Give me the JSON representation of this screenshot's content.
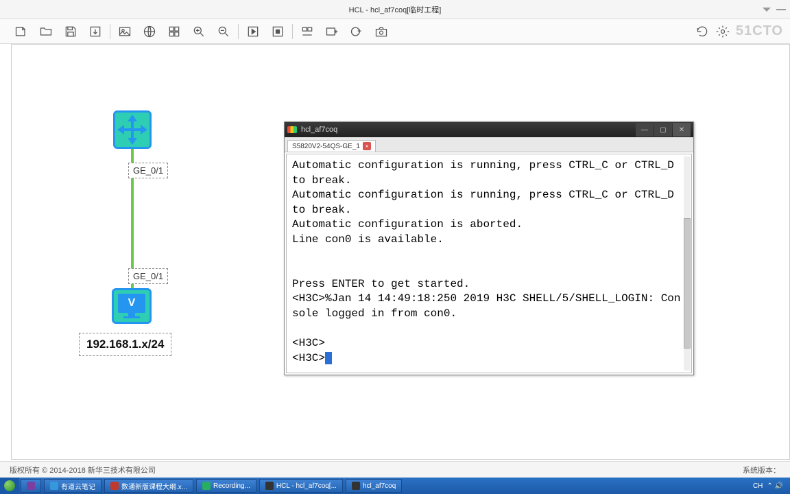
{
  "window": {
    "title": "HCL - hcl_af7coq[临时工程]"
  },
  "watermark": "51CTO",
  "topology": {
    "port1": "GE_0/1",
    "port2": "GE_0/1",
    "ip_label": "192.168.1.x/24",
    "pc_letter": "V"
  },
  "terminal": {
    "title": "hcl_af7coq",
    "tab": "S5820V2-54QS-GE_1",
    "lines": [
      "Automatic configuration is running, press CTRL_C or CTRL_D to break.",
      "Automatic configuration is running, press CTRL_C or CTRL_D to break.",
      "Automatic configuration is aborted.",
      "Line con0 is available.",
      "",
      "",
      "Press ENTER to get started.",
      "<H3C>%Jan 14 14:49:18:250 2019 H3C SHELL/5/SHELL_LOGIN: Console logged in from con0.",
      "",
      "<H3C>",
      "<H3C>"
    ]
  },
  "footer": {
    "copyright": "版权所有 © 2014-2018 新华三技术有限公司",
    "version_label": "系统版本："
  },
  "taskbar": {
    "items": [
      "有道云笔记",
      "数通新版课程大纲.x...",
      "Recording...",
      "HCL - hcl_af7coq[...",
      "hcl_af7coq"
    ],
    "ime": "CH"
  }
}
